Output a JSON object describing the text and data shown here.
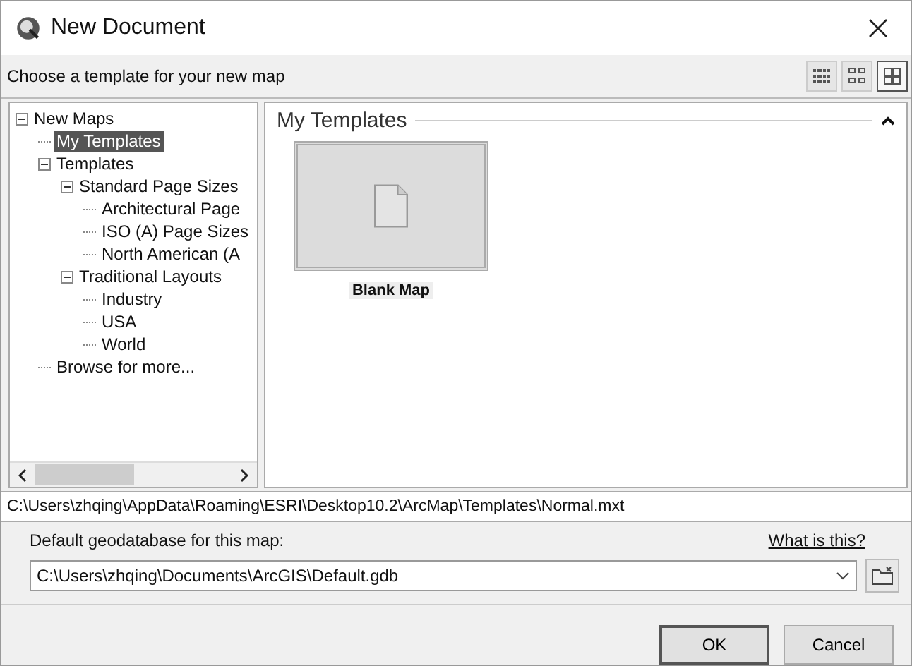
{
  "window": {
    "title": "New Document"
  },
  "header": {
    "text": "Choose a template for your new map",
    "views": [
      {
        "selected": false,
        "kind": "list"
      },
      {
        "selected": false,
        "kind": "small"
      },
      {
        "selected": true,
        "kind": "large"
      }
    ]
  },
  "tree": [
    {
      "label": "New Maps",
      "expanded": true,
      "selected": false,
      "children": [
        {
          "label": "My Templates",
          "selected": true
        },
        {
          "label": "Templates",
          "expanded": true,
          "selected": false,
          "children": [
            {
              "label": "Standard Page Sizes",
              "expanded": true,
              "selected": false,
              "children": [
                {
                  "label": "Architectural Page",
                  "selected": false
                },
                {
                  "label": "ISO (A) Page Sizes",
                  "selected": false
                },
                {
                  "label": "North American (A",
                  "selected": false
                }
              ]
            },
            {
              "label": "Traditional Layouts",
              "expanded": true,
              "selected": false,
              "children": [
                {
                  "label": "Industry",
                  "selected": false
                },
                {
                  "label": "USA",
                  "selected": false
                },
                {
                  "label": "World",
                  "selected": false
                }
              ]
            }
          ]
        },
        {
          "label": "Browse for more...",
          "selected": false
        }
      ]
    }
  ],
  "section": {
    "title": "My Templates",
    "templates": [
      {
        "label": "Blank Map"
      }
    ]
  },
  "path": "C:\\Users\\zhqing\\AppData\\Roaming\\ESRI\\Desktop10.2\\ArcMap\\Templates\\Normal.mxt",
  "geodatabase": {
    "label": "Default geodatabase for this map:",
    "link": "What is this?",
    "value": "C:\\Users\\zhqing\\Documents\\ArcGIS\\Default.gdb"
  },
  "buttons": [
    "OK",
    "Cancel"
  ]
}
